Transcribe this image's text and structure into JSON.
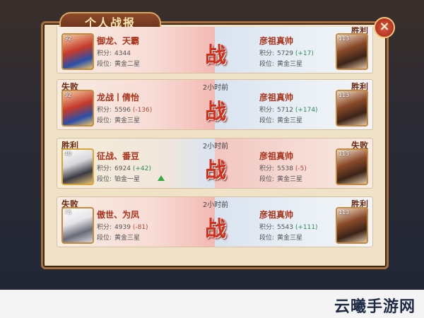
{
  "window": {
    "title": "个人战报",
    "close_label": "×"
  },
  "vs_label": "战",
  "score_label": "积分:",
  "rank_label": "段位:",
  "entries": [
    {
      "time": "",
      "left_result": "",
      "right_result": "胜利",
      "left": {
        "level": "92",
        "name": "御龙、天霸",
        "score": "4344",
        "change": "",
        "rank": "黄金二星"
      },
      "right": {
        "level": "113",
        "name": "彦祖真帅",
        "score": "5729",
        "change": "(+17)",
        "rank": "黄金三星"
      }
    },
    {
      "time": "2小时前",
      "left_result": "失败",
      "right_result": "胜利",
      "left": {
        "level": "92",
        "name": "龙战丨倩怡",
        "score": "5596",
        "change": "(-136)",
        "rank": "黄金三星"
      },
      "right": {
        "level": "113",
        "name": "彦祖真帅",
        "score": "5712",
        "change": "(+174)",
        "rank": "黄金三星"
      }
    },
    {
      "time": "2小时前",
      "left_result": "胜利",
      "right_result": "失败",
      "left": {
        "level": "40",
        "name": "征战、番豆",
        "score": "6924",
        "change": "(+42)",
        "rank": "铂金一星"
      },
      "right": {
        "level": "113",
        "name": "彦祖真帅",
        "score": "5538",
        "change": "(-5)",
        "rank": "黄金三星"
      }
    },
    {
      "time": "2小时前",
      "left_result": "失败",
      "right_result": "胜利",
      "left": {
        "level": "75",
        "name": "傲世、为凤",
        "score": "4939",
        "change": "(-81)",
        "rank": "黄金三星"
      },
      "right": {
        "level": "113",
        "name": "彦祖真帅",
        "score": "5543",
        "change": "(+111)",
        "rank": "黄金三星"
      }
    }
  ],
  "watermark": "云曦手游网"
}
